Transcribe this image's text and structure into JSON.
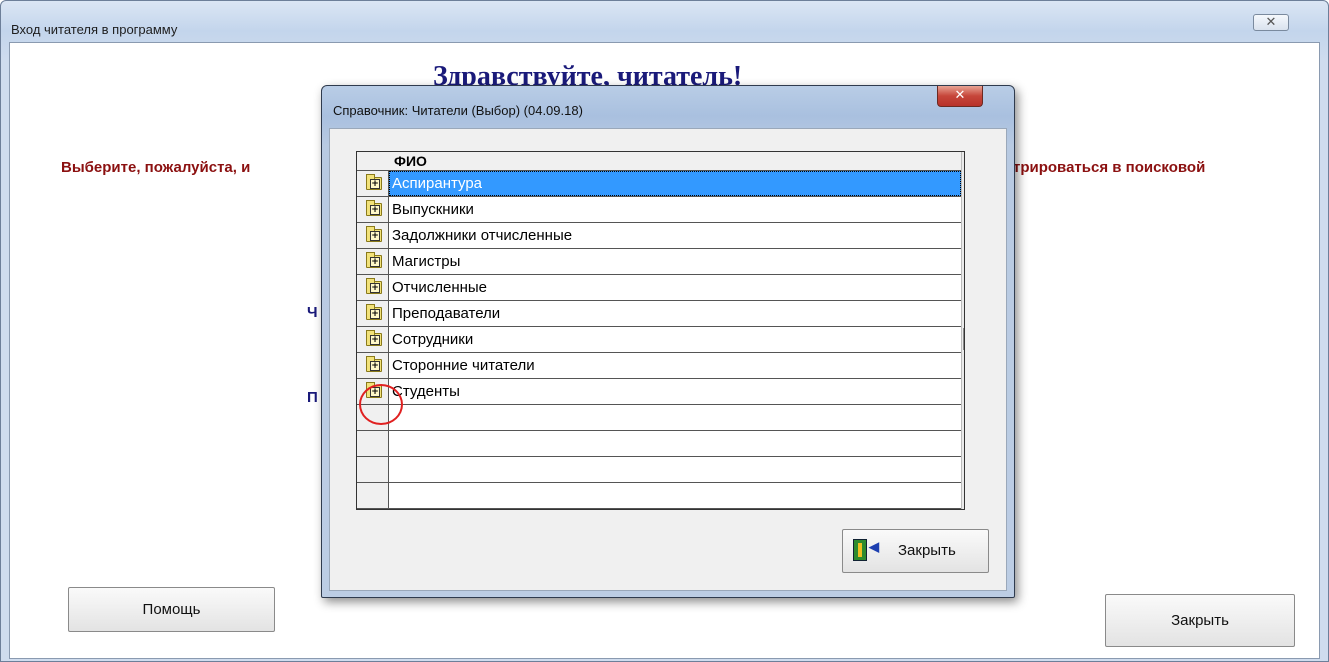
{
  "window": {
    "title": "Вход читателя в программу",
    "close_glyph": "✕",
    "greeting": "Здравствуйте, читатель!",
    "prompt_left": "Выберите, пожалуйста, и",
    "prompt_right": "трироваться в поисковой",
    "fragment_1": "Ч",
    "fragment_2": "П",
    "help_label": "Помощь",
    "close_label": "Закрыть"
  },
  "dialog": {
    "title": "Справочник: Читатели (Выбор) (04.09.18)",
    "close_glyph": "✕",
    "column_header": "ФИО",
    "folder_icon_glyph": "+",
    "selected_index": 0,
    "rows": [
      "Аспирантура",
      "Выпускники",
      "Задолжники отчисленные",
      "Магистры",
      "Отчисленные",
      "Преподаватели",
      "Сотрудники",
      "Сторонние читатели",
      "Студенты"
    ],
    "empty_rows": 4,
    "close_button_label": "Закрыть",
    "scroll_up_glyph": "▲",
    "scroll_down_glyph": "▼"
  },
  "annotation": {
    "color": "#e02020",
    "target": "Студенты"
  }
}
